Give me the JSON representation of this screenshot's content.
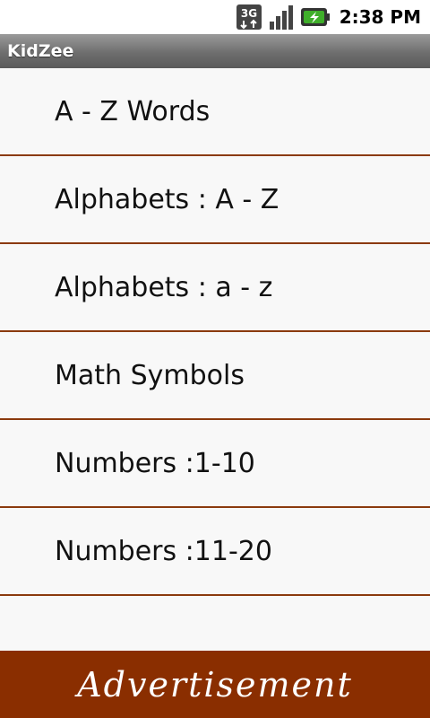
{
  "status_bar": {
    "network_label": "3G",
    "time": "2:38 PM",
    "icons": [
      "network-3g-icon",
      "signal-strength-icon",
      "battery-charging-icon"
    ]
  },
  "app": {
    "title": "KidZee"
  },
  "menu": {
    "items": [
      {
        "label": "A - Z Words"
      },
      {
        "label": "Alphabets : A - Z"
      },
      {
        "label": "Alphabets : a - z"
      },
      {
        "label": "Math Symbols"
      },
      {
        "label": "Numbers :1-10"
      },
      {
        "label": "Numbers :11-20"
      }
    ]
  },
  "ad": {
    "label": "Advertisement"
  },
  "colors": {
    "divider": "#8b3a0e",
    "ad_background": "#8a2e00",
    "title_bar": "#6e6e6e",
    "list_background": "#f8f8f8"
  }
}
